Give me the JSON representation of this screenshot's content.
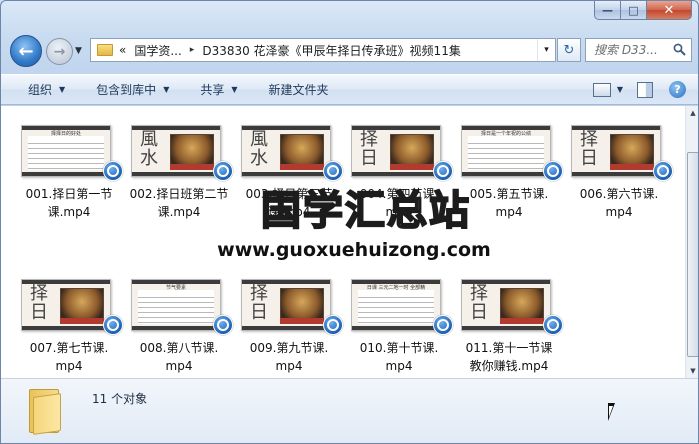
{
  "window": {
    "caption": {
      "minimize": "—",
      "maximize": "□",
      "close": "✕"
    }
  },
  "nav": {
    "back_glyph": "←",
    "forward_glyph": "→",
    "history_glyph": "▼",
    "crumb_overflow": "«",
    "crumbs": [
      "国学资...",
      "D33830 花泽豪《甲辰年择日传承班》视频11集"
    ],
    "crumb_sep": "▸",
    "dropdown_glyph": "▾",
    "refresh_glyph": "↻",
    "search_placeholder": "搜索 D33..."
  },
  "toolbar": {
    "organize": "组织",
    "include_library": "包含到库中",
    "share": "共享",
    "new_folder": "新建文件夹",
    "caret": "▼",
    "help_glyph": "?"
  },
  "files": [
    {
      "name": "001.择日第一节课.mp4",
      "line1": "001.择日第一节",
      "line2": "课.mp4",
      "thumb": "doc",
      "doc_title": "择择日的好处"
    },
    {
      "name": "002.择日班第二节课.mp4",
      "line1": "002.择日班第二节",
      "line2": "课.mp4",
      "thumb": "calli",
      "calli": "風水"
    },
    {
      "name": "003.择日第三节课.mp4",
      "line1": "003.择日第三节",
      "line2": "课.mp4",
      "thumb": "calli",
      "calli": "風水"
    },
    {
      "name": "004.第四节课.mp4",
      "line1": "004.第四节课.",
      "line2": "mp4",
      "thumb": "calli",
      "calli": "择日"
    },
    {
      "name": "005.第五节课.mp4",
      "line1": "005.第五节课.",
      "line2": "mp4",
      "thumb": "doc",
      "doc_title": "择日是一个年祝的公绩"
    },
    {
      "name": "006.第六节课.mp4",
      "line1": "006.第六节课.",
      "line2": "mp4",
      "thumb": "calli",
      "calli": "择日"
    },
    {
      "name": "007.第七节课.mp4",
      "line1": "007.第七节课.",
      "line2": "mp4",
      "thumb": "calli",
      "calli": "择日"
    },
    {
      "name": "008.第八节课.mp4",
      "line1": "008.第八节课.",
      "line2": "mp4",
      "thumb": "doc",
      "doc_title": "节气要素"
    },
    {
      "name": "009.第九节课.mp4",
      "line1": "009.第九节课.",
      "line2": "mp4",
      "thumb": "calli",
      "calli": "择日"
    },
    {
      "name": "010.第十节课.mp4",
      "line1": "010.第十节课.",
      "line2": "mp4",
      "thumb": "doc",
      "doc_title": "日课 三元二地一时 全部精"
    },
    {
      "name": "011.第十一节课教你赚钱.mp4",
      "line1": "011.第十一节课",
      "line2": "教你赚钱.mp4",
      "thumb": "calli",
      "calli": "择日"
    }
  ],
  "watermark": {
    "title": "国学汇总站",
    "url": "www.guoxuehuizong.com"
  },
  "details": {
    "count": "11 个对象"
  },
  "colors": {
    "accent": "#2f79c8",
    "badge": "#1c5fb3",
    "close": "#c2482f"
  }
}
